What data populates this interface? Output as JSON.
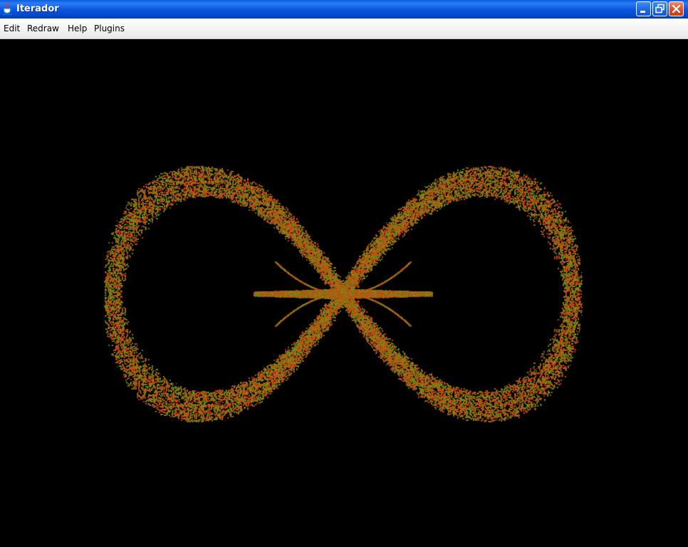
{
  "window": {
    "title": "Iterador",
    "icon": "java-cup-icon",
    "controls": [
      "minimize-icon",
      "restore-icon",
      "close-icon"
    ]
  },
  "menu": {
    "items": [
      {
        "label": "Edit"
      },
      {
        "label": "Redraw"
      },
      {
        "label": "Help"
      },
      {
        "label": "Plugins"
      }
    ]
  },
  "canvas": {
    "background": "#000000",
    "point_colors": [
      "#cc3a10",
      "#6f9a16",
      "#a86a12",
      "#e0401a",
      "#5c8a12"
    ]
  }
}
